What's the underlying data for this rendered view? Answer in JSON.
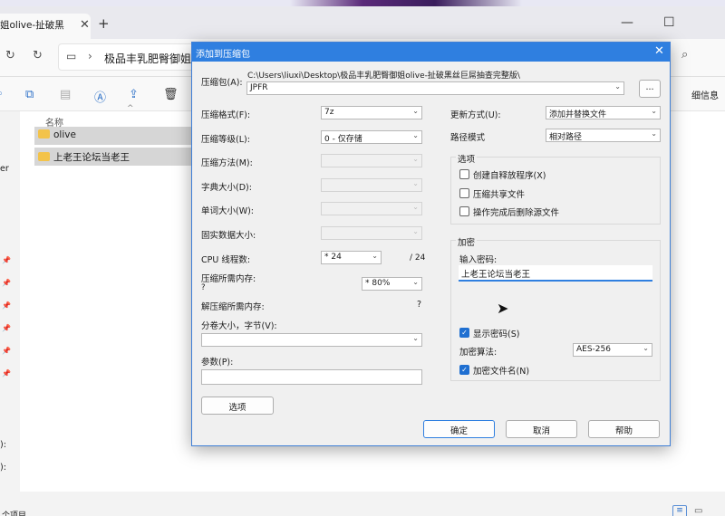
{
  "explorer": {
    "tab_title": "姐olive-扯破黑",
    "address_path": "极品丰乳肥臀御姐o",
    "details_label": "细信息",
    "column_name": "名称",
    "files": [
      "olive",
      "上老王论坛当老王"
    ],
    "nav_letters": [
      "er",
      "):",
      "):"
    ],
    "status_text": "个项目"
  },
  "dialog": {
    "title": "添加到压缩包",
    "archive_label": "压缩包(A):",
    "archive_path": "C:\\Users\\liuxi\\Desktop\\极品丰乳肥臀御姐olive-扯破黑丝巨屌抽查完整版\\",
    "archive_name": "JPFR",
    "browse_button": "...",
    "left": {
      "format_label": "压缩格式(F):",
      "format_value": "7z",
      "level_label": "压缩等级(L):",
      "level_value": "0 - 仅存储",
      "method_label": "压缩方法(M):",
      "dict_label": "字典大小(D):",
      "word_label": "单词大小(W):",
      "solid_label": "固实数据大小:",
      "cpu_label": "CPU 线程数:",
      "cpu_value": "* 24",
      "cpu_total": "/ 24",
      "mem_label": "压缩所需内存:",
      "mem_q": "?",
      "mem_value": "* 80%",
      "decomp_label": "解压缩所需内存:",
      "decomp_q": "?",
      "volume_label": "分卷大小，字节(V):",
      "params_label": "参数(P):",
      "options_button": "选项"
    },
    "right": {
      "update_label": "更新方式(U):",
      "update_value": "添加并替换文件",
      "path_label": "路径模式",
      "path_value": "相对路径",
      "options_title": "选项",
      "opt_sfx": "创建自释放程序(X)",
      "opt_shared": "压缩共享文件",
      "opt_delete": "操作完成后删除源文件",
      "enc_title": "加密",
      "pwd_label": "输入密码:",
      "pwd_value": "上老王论坛当老王",
      "show_pwd": "显示密码(S)",
      "enc_method_label": "加密算法:",
      "enc_method_value": "AES-256",
      "enc_names": "加密文件名(N)"
    },
    "ok_button": "确定",
    "cancel_button": "取消",
    "help_button": "帮助"
  }
}
